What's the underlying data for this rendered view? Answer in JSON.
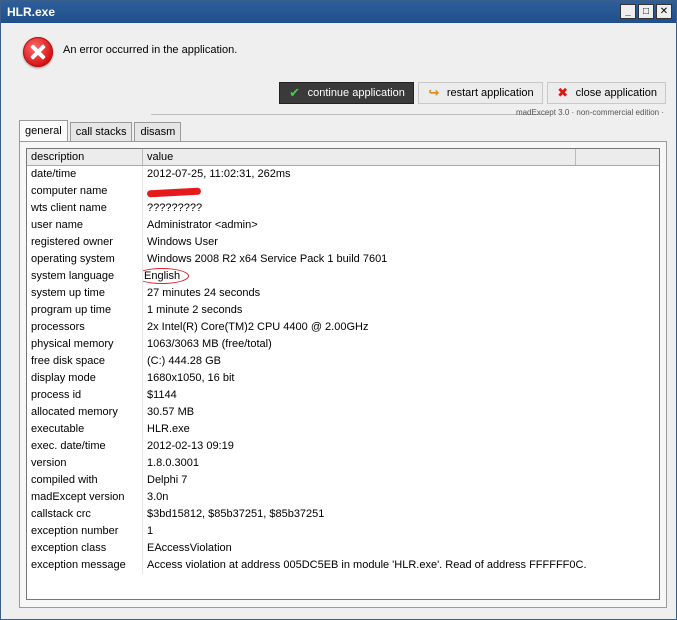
{
  "window": {
    "title": "HLR.exe",
    "controls": {
      "minimize": "_",
      "maximize": "□",
      "close": "✕"
    }
  },
  "error": {
    "message": "An error occurred in the application."
  },
  "buttons": {
    "continue": "continue application",
    "restart": "restart application",
    "close": "close application"
  },
  "credit": "madExcept 3.0 · non-commercial edition ·",
  "tabs": [
    "general",
    "call stacks",
    "disasm"
  ],
  "grid": {
    "headers": [
      "description",
      "value",
      ""
    ],
    "rows": [
      {
        "key": "date/time",
        "value": "2012-07-25, 11:02:31, 262ms"
      },
      {
        "key": "computer name",
        "value": ""
      },
      {
        "key": "wts client name",
        "value": "?????????"
      },
      {
        "key": "user name",
        "value": "Administrator  <admin>"
      },
      {
        "key": "registered owner",
        "value": "Windows User"
      },
      {
        "key": "operating system",
        "value": "Windows 2008 R2 x64 Service Pack 1 build 7601"
      },
      {
        "key": "system language",
        "value": "English"
      },
      {
        "key": "system up time",
        "value": "27 minutes 24 seconds"
      },
      {
        "key": "program up time",
        "value": "1 minute 2 seconds"
      },
      {
        "key": "processors",
        "value": "2x Intel(R) Core(TM)2 CPU 4400 @ 2.00GHz"
      },
      {
        "key": "physical memory",
        "value": "1063/3063 MB (free/total)"
      },
      {
        "key": "free disk space",
        "value": "(C:) 444.28 GB"
      },
      {
        "key": "display mode",
        "value": "1680x1050, 16 bit"
      },
      {
        "key": "process id",
        "value": "$1144"
      },
      {
        "key": "allocated memory",
        "value": "30.57 MB"
      },
      {
        "key": "executable",
        "value": "HLR.exe"
      },
      {
        "key": "exec. date/time",
        "value": "2012-02-13 09:19"
      },
      {
        "key": "version",
        "value": "1.8.0.3001"
      },
      {
        "key": "compiled with",
        "value": "Delphi 7"
      },
      {
        "key": "madExcept version",
        "value": "3.0n"
      },
      {
        "key": "callstack crc",
        "value": "$3bd15812, $85b37251, $85b37251"
      },
      {
        "key": "exception number",
        "value": "1"
      },
      {
        "key": "exception class",
        "value": "EAccessViolation"
      },
      {
        "key": "exception message",
        "value": "Access violation at address 005DC5EB in module 'HLR.exe'. Read of address FFFFFF0C."
      }
    ]
  },
  "colors": {
    "titlebar": "#1f4f8c",
    "error_red": "#d41111",
    "annotation_red": "#e51a1a"
  },
  "icons": {
    "error": "error-circle-x",
    "continue": "checkmark",
    "restart": "restart-arrow",
    "close": "red-x"
  }
}
